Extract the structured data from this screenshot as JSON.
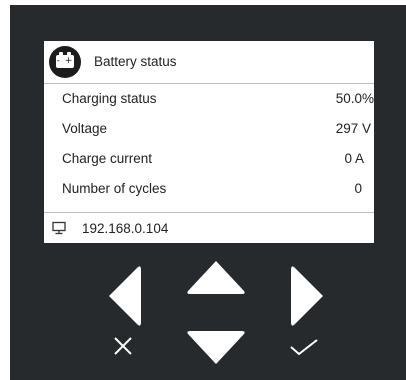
{
  "panel": {
    "title": "Battery status",
    "rows": [
      {
        "label": "Charging status",
        "value": "50.0%"
      },
      {
        "label": "Voltage",
        "value": "297 V"
      },
      {
        "label": "Charge current",
        "value": "0 A"
      },
      {
        "label": "Number of cycles",
        "value": "0"
      }
    ],
    "ip_address": "192.168.0.104"
  },
  "icons": {
    "header": "battery-icon",
    "footer": "monitor-icon",
    "left": "left-arrow-button",
    "up": "up-arrow-button",
    "right": "right-arrow-button",
    "down": "down-arrow-button",
    "cancel": "x-cancel-icon",
    "confirm": "checkmark-icon"
  },
  "colors": {
    "device": "#262a2c",
    "screen": "#ffffff",
    "controls": "#ffffff"
  }
}
